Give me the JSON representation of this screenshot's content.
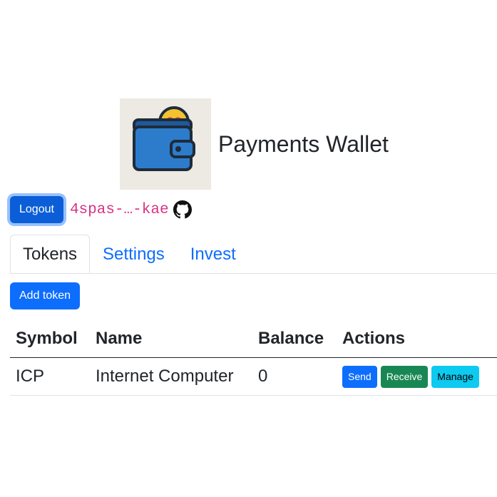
{
  "app": {
    "title": "Payments Wallet",
    "logo_icon": "wallet-infinity-logo"
  },
  "user": {
    "logout_label": "Logout",
    "principal": "4spas-…-kae",
    "github_icon": "github-icon"
  },
  "tabs": [
    {
      "label": "Tokens",
      "active": true
    },
    {
      "label": "Settings",
      "active": false
    },
    {
      "label": "Invest",
      "active": false
    }
  ],
  "tokens": {
    "add_label": "Add token",
    "columns": [
      "Symbol",
      "Name",
      "Balance",
      "Actions"
    ],
    "rows": [
      {
        "symbol": "ICP",
        "name": "Internet Computer",
        "balance": "0",
        "actions": {
          "send": "Send",
          "receive": "Receive",
          "manage": "Manage"
        }
      }
    ]
  },
  "colors": {
    "primary": "#0d6efd",
    "success": "#198754",
    "info": "#0dcaf0",
    "code": "#d63384"
  }
}
